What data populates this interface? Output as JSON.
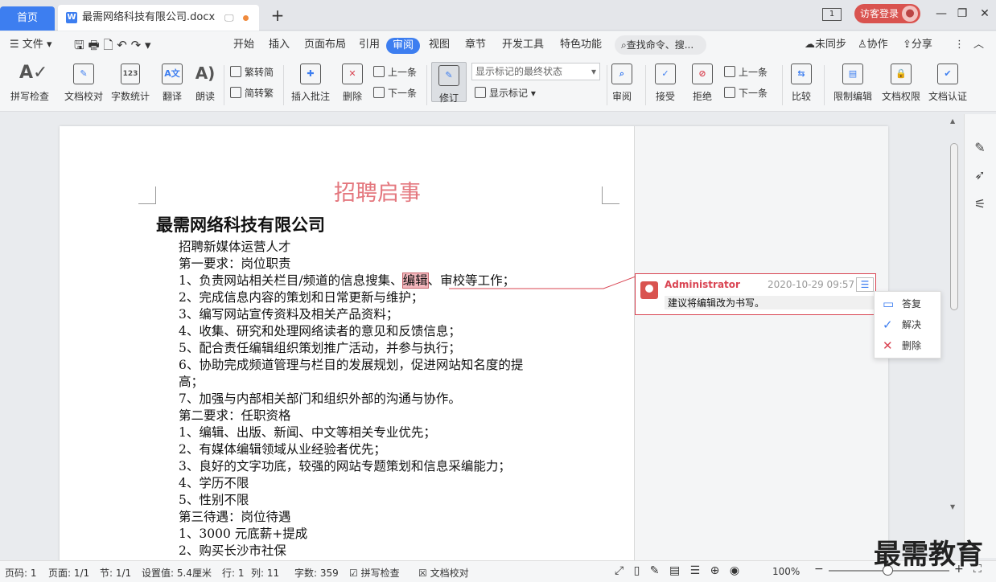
{
  "tabs": {
    "home": "首页",
    "document": "最需网络科技有限公司.docx",
    "add": "+"
  },
  "window": {
    "page_count_indicator": "1",
    "guest_login": "访客登录",
    "minimize": "—",
    "restore": "❐",
    "maximize": "☐",
    "close": "✕"
  },
  "menu": {
    "file": "文件",
    "items": [
      "开始",
      "插入",
      "页面布局",
      "引用",
      "审阅",
      "视图",
      "章节",
      "开发工具",
      "特色功能"
    ],
    "search_placeholder": "查找命令、搜...",
    "right": [
      "未同步",
      "协作",
      "分享"
    ]
  },
  "ribbon": {
    "spell_check": "拼写检查",
    "doc_proof": "文档校对",
    "word_count": "字数统计",
    "translate": "翻译",
    "read_aloud": "朗读",
    "trad_simp": "繁转简",
    "simp_trad": "简转繁",
    "insert_comment": "插入批注",
    "delete": "删除",
    "prev": "上一条",
    "next": "下一条",
    "track": "修订",
    "markup_select": "显示标记的最终状态",
    "show_markup": "显示标记",
    "review": "审阅",
    "accept": "接受",
    "reject": "拒绝",
    "prev2": "上一条",
    "next2": "下一条",
    "compare": "比较",
    "restrict": "限制编辑",
    "doc_rights": "文档权限",
    "doc_cert": "文档认证"
  },
  "document": {
    "title": "招聘启事",
    "company": "最需网络科技有限公司",
    "lines": [
      "招聘新媒体运营人才",
      "第一要求：岗位职责",
      "1、负责网站相关栏目/频道的信息搜集、",
      "2、完成信息内容的策划和日常更新与维护；",
      "3、编写网站宣传资料及相关产品资料；",
      "4、收集、研究和处理网络读者的意见和反馈信息；",
      "5、配合责任编辑组织策划推广活动，并参与执行；",
      "6、协助完成频道管理与栏目的发展规划，促进网站知名度的提",
      "高；",
      "7、加强与内部相关部门和组织外部的沟通与协作。",
      "第二要求：任职资格",
      "1、编辑、出版、新闻、中文等相关专业优先；",
      "2、有媒体编辑领域从业经验者优先；",
      "3、良好的文字功底，较强的网站专题策划和信息采编能力；",
      "4、学历不限",
      "5、性别不限",
      "第三待遇：岗位待遇",
      "1、3000 元底薪+提成",
      "2、购买长沙市社保"
    ],
    "highlight": "编辑",
    "line3_tail": "、审校等工作；"
  },
  "comment": {
    "author": "Administrator",
    "time": "2020-10-29 09:57",
    "text": "建议将编辑改为书写。"
  },
  "context_menu": {
    "reply": "答复",
    "resolve": "解决",
    "delete": "删除"
  },
  "status": {
    "page_code": "页码: 1",
    "page": "页面: 1/1",
    "section": "节: 1/1",
    "setting": "设置值: 5.4厘米",
    "row": "行: 1",
    "col": "列: 11",
    "word_count": "字数: 359",
    "spell_check": "拼写检查",
    "doc_proof": "文档校对",
    "zoom": "100%"
  },
  "watermark": "最需教育",
  "colors": {
    "accent": "#3d7ef0",
    "comment_red": "#d94452",
    "title_pink": "#e4777e",
    "highlight": "#f3b7bd"
  }
}
